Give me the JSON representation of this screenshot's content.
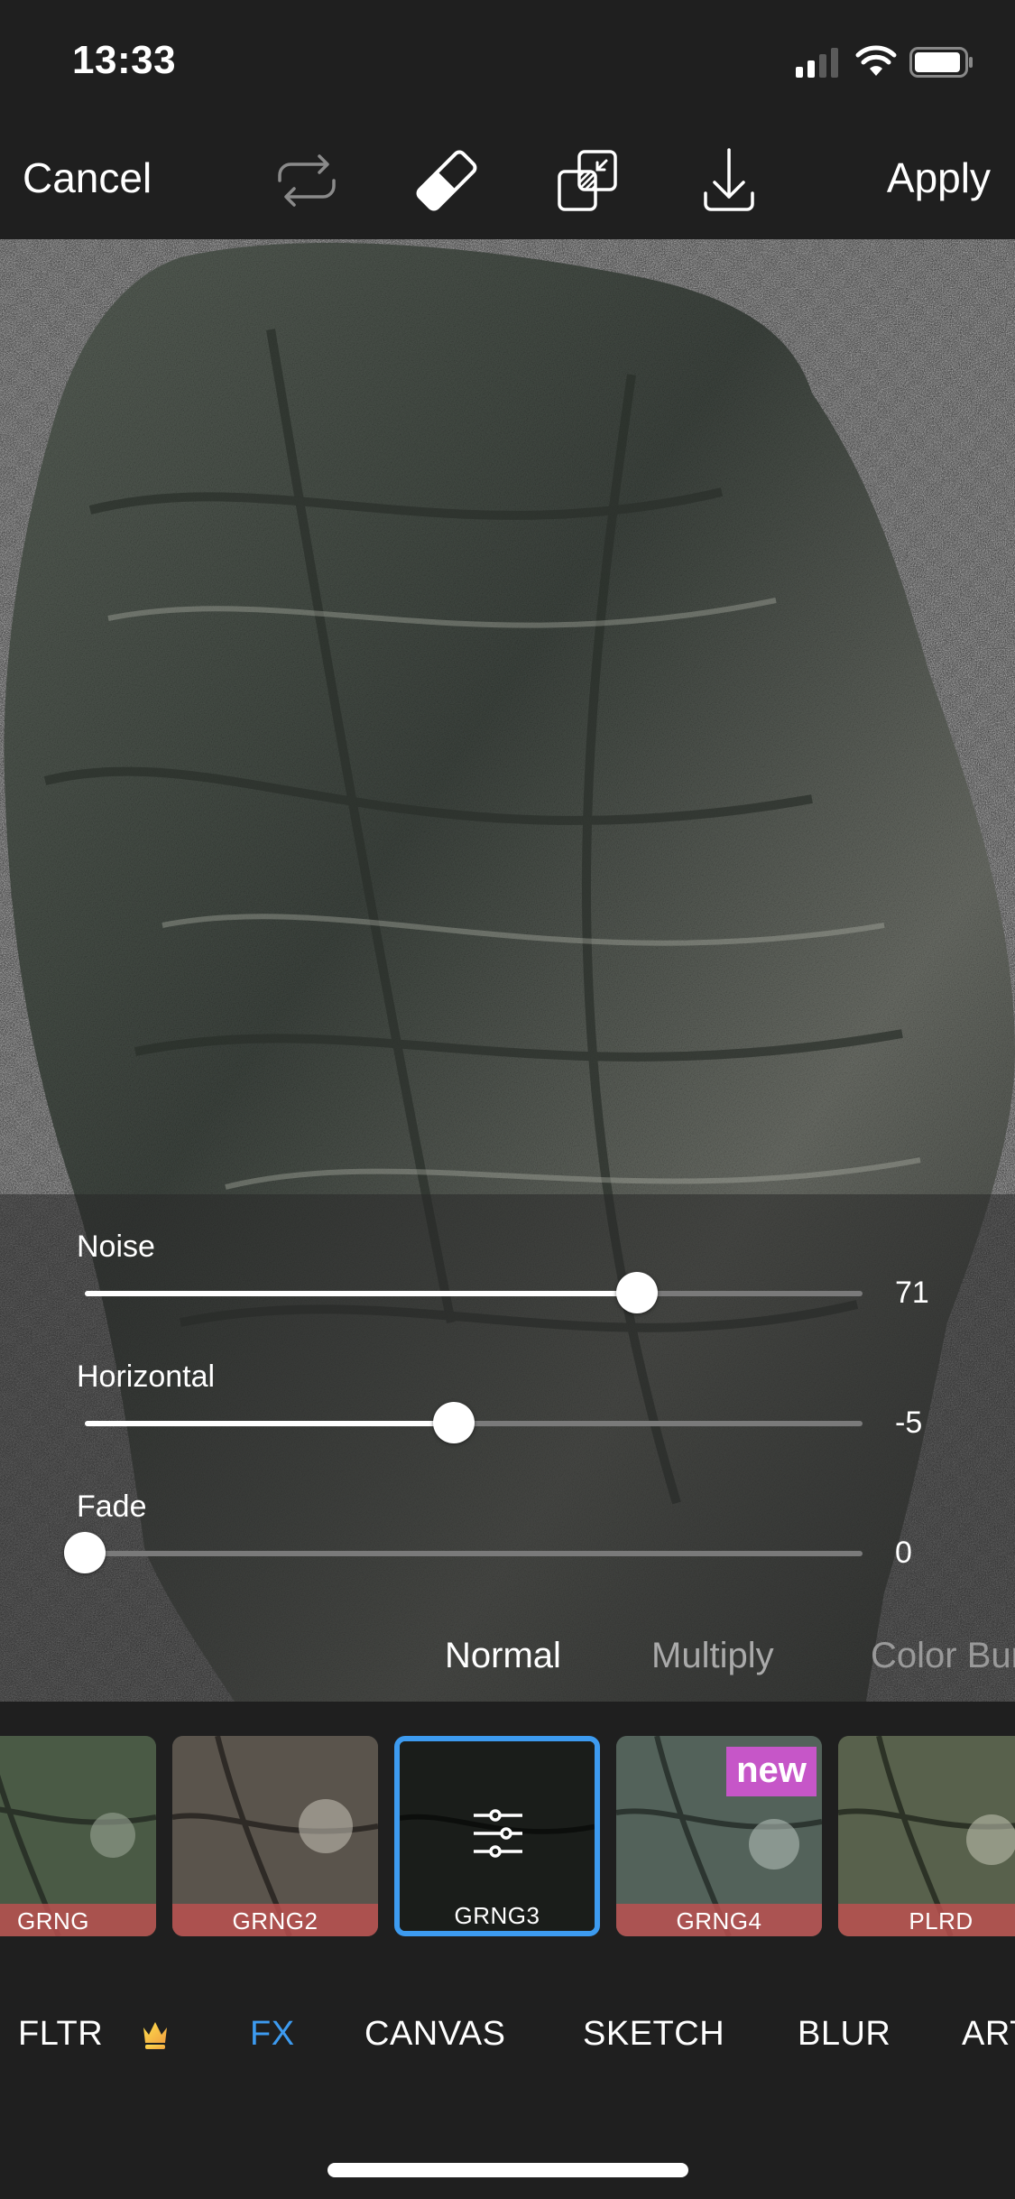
{
  "status_bar": {
    "time": "13:33",
    "icons": [
      "cellular-signal-icon",
      "wifi-icon",
      "battery-icon"
    ]
  },
  "toolbar": {
    "cancel_label": "Cancel",
    "apply_label": "Apply",
    "tools": [
      {
        "name": "repeat-icon",
        "enabled": false
      },
      {
        "name": "eraser-icon",
        "enabled": true
      },
      {
        "name": "blend-overlay-icon",
        "enabled": true
      },
      {
        "name": "download-icon",
        "enabled": true
      }
    ]
  },
  "sliders": [
    {
      "label": "Noise",
      "value": "71",
      "position": 0.71
    },
    {
      "label": "Horizontal",
      "value": "-5",
      "position": 0.475
    },
    {
      "label": "Fade",
      "value": "0",
      "position": 0.0
    }
  ],
  "blend_modes": {
    "items": [
      "Normal",
      "Multiply",
      "Color Burn"
    ],
    "selected": "Normal"
  },
  "effects": {
    "items": [
      {
        "label": "GRNG",
        "selected": false,
        "badge": ""
      },
      {
        "label": "GRNG2",
        "selected": false,
        "badge": ""
      },
      {
        "label": "GRNG3",
        "selected": true,
        "badge": ""
      },
      {
        "label": "GRNG4",
        "selected": false,
        "badge": "new"
      },
      {
        "label": "PLRD",
        "selected": false,
        "badge": ""
      }
    ],
    "selected_icon": "sliders-settings-icon"
  },
  "categories": {
    "items": [
      "FLTR",
      "FX",
      "CANVAS",
      "SKETCH",
      "BLUR",
      "ART"
    ],
    "active": "FX",
    "premium_icon": "crown-icon"
  },
  "colors": {
    "accent": "#3d9bf0",
    "background": "#1f1f1f",
    "label_bar": "#be5050",
    "new_badge": "#c656c8",
    "crown": "#f5c542"
  }
}
